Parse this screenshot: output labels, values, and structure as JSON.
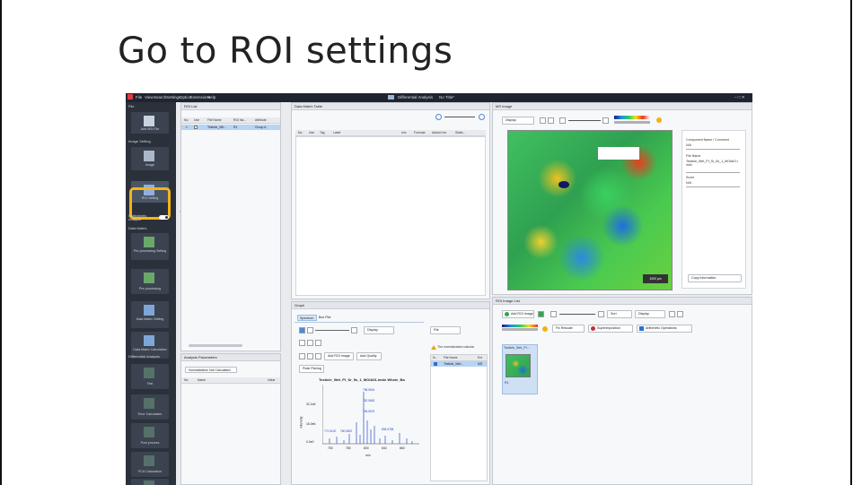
{
  "slide": {
    "title": "Go to ROI settings"
  },
  "app": {
    "menu": [
      "File",
      "View",
      "Search",
      "Settings",
      "Option",
      "Extensions",
      "Help"
    ],
    "window_title": "Differential Analysis",
    "project_name": "No Title*",
    "window_controls": "– □ ✕",
    "sidebar": {
      "sections": {
        "file": "File",
        "image_setting": "Image Setting",
        "collectively_analyze": "Collectively Analyze",
        "data_matrix": "Data Matrix",
        "differential_analysis": "Differential Analysis"
      },
      "buttons": {
        "add_msi_file": "Add MSI File",
        "image": "Image",
        "roi_setting": "ROI Setting",
        "preprocessing_setting": "Pre-processing Setting",
        "preprocessing": "Pre-processing",
        "data_matrix_setting": "Data Matrix Setting",
        "data_matrix_calculation": "Data Matrix Calculation",
        "test": "Test",
        "error_calculation": "Error Calculation",
        "post_process": "Post process",
        "pca_calculation": "PCA Calculation",
        "last": ""
      }
    },
    "roi_list": {
      "title": "ROI List",
      "columns": [
        "No.",
        "Use",
        "File Name",
        "ROI Na...",
        "Attribute"
      ],
      "row": {
        "no": "1",
        "use": "",
        "file": "Testicle_Wh...",
        "roi": "R1",
        "attr": "Group A"
      }
    },
    "analysis_parameters": {
      "title": "Analysis Parameters",
      "button": "Normalization Not Calculated",
      "columns": [
        "No.",
        "Name",
        "Value"
      ]
    },
    "data_matrix_table": {
      "title": "Data Matrix Table",
      "columns": [
        "No.",
        "Use",
        "Tag",
        "Label",
        "m/z",
        "Formula",
        "Adduct Ion",
        "Statis..."
      ]
    },
    "graph": {
      "title": "Graph",
      "tabs": {
        "spectrum": "Spectrum",
        "box_plot": "Box Plot"
      },
      "display_label": "Display",
      "add_roi_image": "Add ROI Image",
      "add_quality": "Add Quality",
      "peak_picking": "Peak Picking",
      "plot_title": "Testicle_Wet_PI_Sr_5s_1_MOIA01.imdx Whole_Ba",
      "ylabel": "Intensity",
      "xlabel": "m/z",
      "y_ticks": [
        "32.1e6",
        "16.0e6",
        "0.0e0"
      ],
      "x_ticks": [
        "750",
        "780",
        "800",
        "840",
        "860"
      ],
      "peak_labels": [
        "798.5544",
        "782.5662",
        "796.5576",
        "772.5120",
        "808.5768",
        "760.5822"
      ],
      "file_dropdown": "File",
      "warning": "The normalization calcula",
      "file_columns": [
        "N...",
        "File Name",
        "Ext"
      ],
      "file_row": {
        "name": "Testicle_Wet...",
        "ext": "MS"
      }
    },
    "ms_image": {
      "title": "MS Image",
      "display_label": "Display",
      "info": {
        "compound_label": "Component Name / Comment",
        "compound_value": "N/A",
        "file_name_label": "File Name",
        "file_name_value": "Testicle_Wet_PI_Sr_5s_1_MOIA01.imdx",
        "score_label": "Score",
        "score_value": "N/A",
        "copy_button": "Copy Information"
      },
      "scale_badge": "1000 µm"
    },
    "roi_image_list": {
      "title": "ROI Image List",
      "add_roi_image": "Add ROI Image",
      "sort": "Sort",
      "display": "Display",
      "fix_rescale": "Fix Rescale",
      "superimposition": "Superimposition",
      "arithmetic": "Arithmetic Operations",
      "item_name": "Testicle_Wet_PI...",
      "item_label": "R1"
    }
  },
  "colors": {
    "highlight": "#f2b51a",
    "sidebar": "#2b313b",
    "selected_row": "#b8d4f3"
  }
}
